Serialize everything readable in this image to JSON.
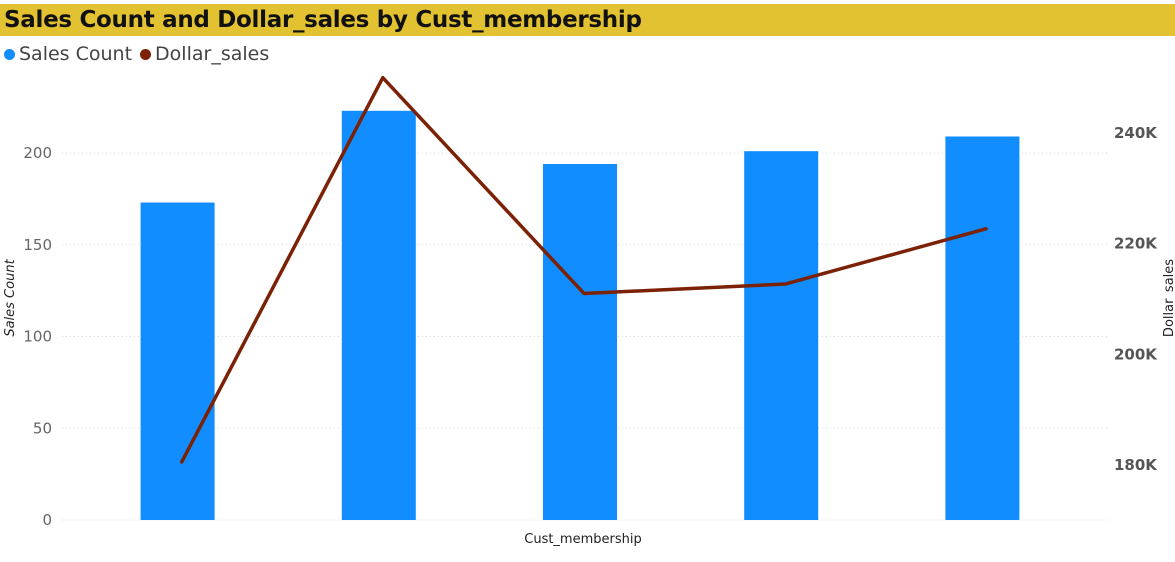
{
  "chart_data": {
    "type": "bar",
    "title": "Sales Count and Dollar_sales by Cust_membership",
    "xlabel": "Cust_membership",
    "ylabel": "Sales Count",
    "y2label": "Dollar_sales",
    "categories": [
      "",
      "",
      "",
      "",
      ""
    ],
    "ylim": [
      0,
      240
    ],
    "y2lim": [
      171000,
      264000
    ],
    "yticks": [
      0,
      50,
      100,
      150,
      200
    ],
    "ytick_labels": [
      "0",
      "50",
      "100",
      "150",
      "200"
    ],
    "y2ticks": [
      180000,
      200000,
      220000,
      240000
    ],
    "y2tick_labels": [
      "180K",
      "200K",
      "220K",
      "240K"
    ],
    "grid": true,
    "legend": "top-left",
    "series": [
      {
        "name": "Sales Count",
        "type": "bar",
        "axis": "left",
        "color": "#118DFF",
        "values": [
          173,
          223,
          194,
          201,
          209
        ]
      },
      {
        "name": "Dollar_sales",
        "type": "line",
        "axis": "right",
        "color": "#7B2106",
        "values": [
          180500,
          250000,
          211000,
          212700,
          222700
        ]
      }
    ]
  },
  "colors": {
    "title_bar": "#E2C230"
  }
}
